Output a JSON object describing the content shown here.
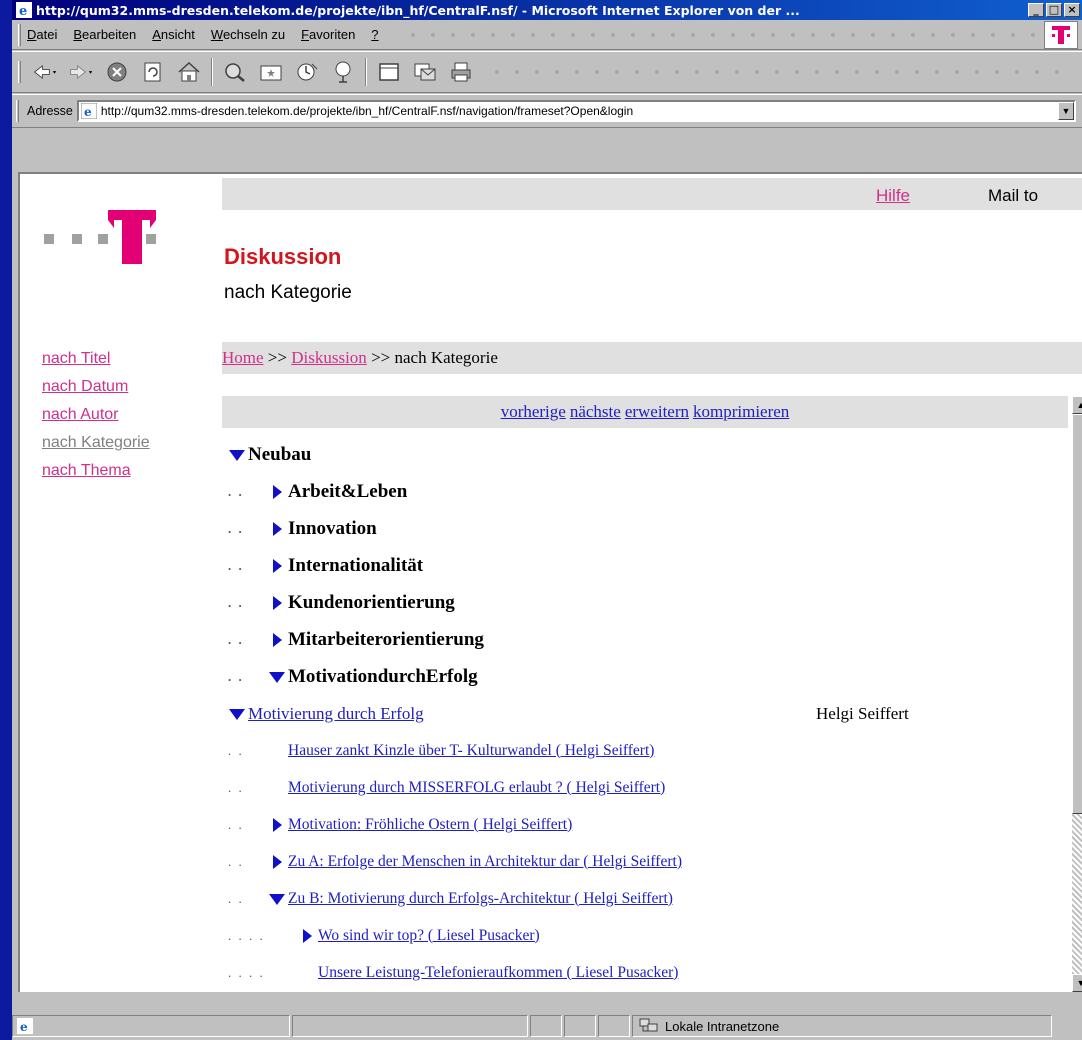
{
  "window": {
    "title": "http://qum32.mms-dresden.telekom.de/projekte/ibn_hf/CentralF.nsf/ - Microsoft Internet Explorer von der ..."
  },
  "menu": {
    "items": [
      {
        "pre": "",
        "u": "D",
        "post": "atei"
      },
      {
        "pre": "",
        "u": "B",
        "post": "earbeiten"
      },
      {
        "pre": "",
        "u": "A",
        "post": "nsicht"
      },
      {
        "pre": "",
        "u": "W",
        "post": "echseln zu"
      },
      {
        "pre": "",
        "u": "F",
        "post": "avoriten"
      },
      {
        "pre": "",
        "u": "?",
        "post": ""
      }
    ]
  },
  "address": {
    "label": "Adresse",
    "url": "http://qum32.mms-dresden.telekom.de/projekte/ibn_hf/CentralF.nsf/navigation/frameset?Open&login"
  },
  "page": {
    "help_link": "Hilfe",
    "mail_to": "Mail to",
    "title": "Diskussion",
    "subtitle": "nach Kategorie",
    "sidenav": [
      "nach Titel",
      "nach Datum",
      "nach Autor",
      "nach Kategorie",
      "nach Thema"
    ],
    "breadcrumb": {
      "home": "Home",
      "sep1": ">>",
      "diskussion": "Diskussion",
      "sep2": ">>",
      "current": "nach Kategorie"
    },
    "navlinks": [
      "vorherige",
      "nächste",
      "erweitern",
      "komprimieren"
    ],
    "tree": [
      {
        "dots": "",
        "tri": "down",
        "text": "Neubau",
        "kind": "cat"
      },
      {
        "dots": ". .",
        "tri": "right",
        "text": "Arbeit&Leben",
        "kind": "cat"
      },
      {
        "dots": ". .",
        "tri": "right",
        "text": "Innovation",
        "kind": "cat"
      },
      {
        "dots": ". .",
        "tri": "right",
        "text": "Internationalität",
        "kind": "cat"
      },
      {
        "dots": ". .",
        "tri": "right",
        "text": "Kundenorientierung",
        "kind": "cat"
      },
      {
        "dots": ". .",
        "tri": "right",
        "text": "Mitarbeiterorientierung",
        "kind": "cat"
      },
      {
        "dots": ". .",
        "tri": "down",
        "text": "MotivationdurchErfolg",
        "kind": "cat"
      },
      {
        "dots": "",
        "tri": "down",
        "text": "Motivierung durch Erfolg",
        "kind": "top",
        "author": "Helgi Seiffert"
      },
      {
        "dots": ". .",
        "tri": "",
        "text": "Hauser zankt Kinzle über T- Kulturwandel ( Helgi Seiffert)",
        "kind": "sub"
      },
      {
        "dots": ". .",
        "tri": "",
        "text": "Motivierung durch MISSERFOLG erlaubt ? ( Helgi Seiffert)",
        "kind": "sub"
      },
      {
        "dots": ". .",
        "tri": "right",
        "text": "Motivation: Fröhliche Ostern ( Helgi Seiffert)",
        "kind": "sub"
      },
      {
        "dots": ". .",
        "tri": "right",
        "text": "Zu A: Erfolge der Menschen in Architektur dar ( Helgi Seiffert)",
        "kind": "sub"
      },
      {
        "dots": ". .",
        "tri": "down",
        "text": "Zu B: Motivierung durch Erfolgs-Architektur ( Helgi Seiffert)",
        "kind": "sub"
      },
      {
        "dots": ". . . .",
        "tri": "right",
        "text": "Wo sind wir top? ( Liesel Pusacker)",
        "kind": "sub"
      },
      {
        "dots": ". . . .",
        "tri": "",
        "text": "Unsere Leistung-Telefonieraufkommen ( Liesel Pusacker)",
        "kind": "sub"
      }
    ]
  },
  "status": {
    "zone": "Lokale Intranetzone"
  },
  "colors": {
    "link": "#2020c0",
    "magenta": "#d0308a",
    "title_red": "#d2161e",
    "desktop": "#0b1a9e"
  }
}
